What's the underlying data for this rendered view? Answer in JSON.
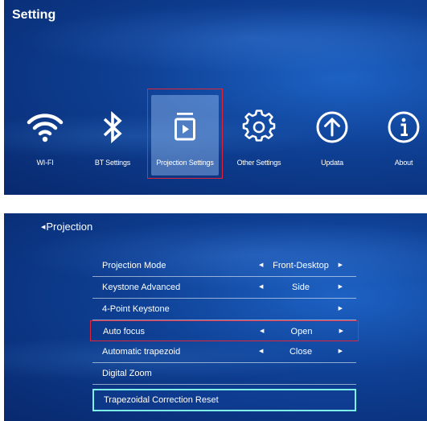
{
  "top_panel": {
    "title": "Setting",
    "nav_items": [
      {
        "label": "WI-FI",
        "icon": "wifi-icon"
      },
      {
        "label": "BT Settings",
        "icon": "bluetooth-icon"
      },
      {
        "label": "Projection Settings",
        "icon": "projection-icon",
        "selected": true
      },
      {
        "label": "Other Settings",
        "icon": "gear-icon"
      },
      {
        "label": "Updata",
        "icon": "upload-arrow-icon"
      },
      {
        "label": "About",
        "icon": "info-icon"
      }
    ]
  },
  "bottom_panel": {
    "back_label": "Projection",
    "rows": [
      {
        "label": "Projection Mode",
        "value": "Front-Desktop"
      },
      {
        "label": "Keystone Advanced",
        "value": "Side"
      },
      {
        "label": "4-Point Keystone",
        "value": ""
      },
      {
        "label": "Auto focus",
        "value": "Open"
      },
      {
        "label": "Automatic trapezoid",
        "value": "Close"
      },
      {
        "label": "Digital Zoom"
      },
      {
        "label": "Trapezoidal Correction Reset"
      }
    ]
  },
  "colors": {
    "background": "#0e3f93",
    "highlight_red": "#e0243a",
    "focus_cyan": "#7ff0ea"
  }
}
